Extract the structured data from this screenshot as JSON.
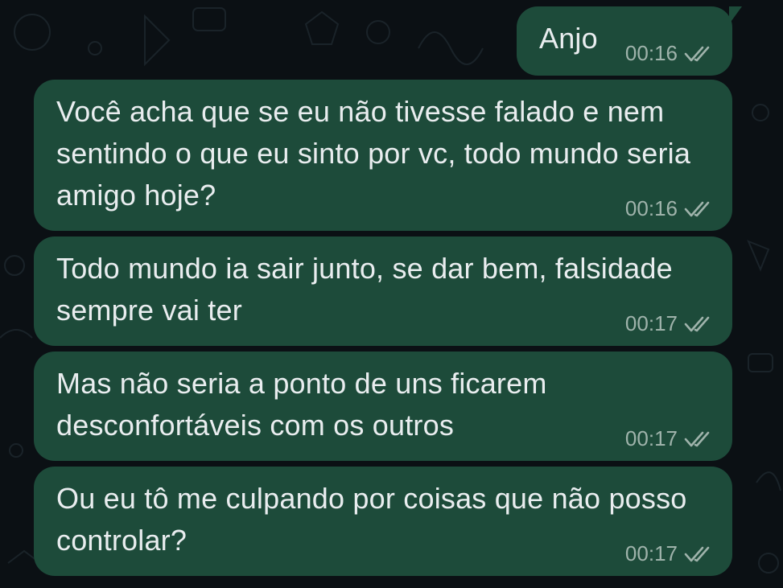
{
  "colors": {
    "background": "#0b1014",
    "bubble": "#1d4b3a",
    "text": "#e9edef",
    "meta": "#9fb3ab"
  },
  "messages": [
    {
      "text": "Anjo",
      "time": "00:16",
      "status_icon": "double-check-icon"
    },
    {
      "text": "Você acha que se eu não tivesse falado e nem sentindo o que eu sinto por vc, todo mundo seria amigo hoje?",
      "time": "00:16",
      "status_icon": "double-check-icon"
    },
    {
      "text": "Todo mundo ia sair junto, se dar bem, falsidade sempre vai ter",
      "time": "00:17",
      "status_icon": "double-check-icon"
    },
    {
      "text": "Mas não seria a ponto de uns ficarem desconfortáveis com os outros",
      "time": "00:17",
      "status_icon": "double-check-icon"
    },
    {
      "text": "Ou eu tô me culpando por coisas que não posso controlar?",
      "time": "00:17",
      "status_icon": "double-check-icon"
    }
  ]
}
